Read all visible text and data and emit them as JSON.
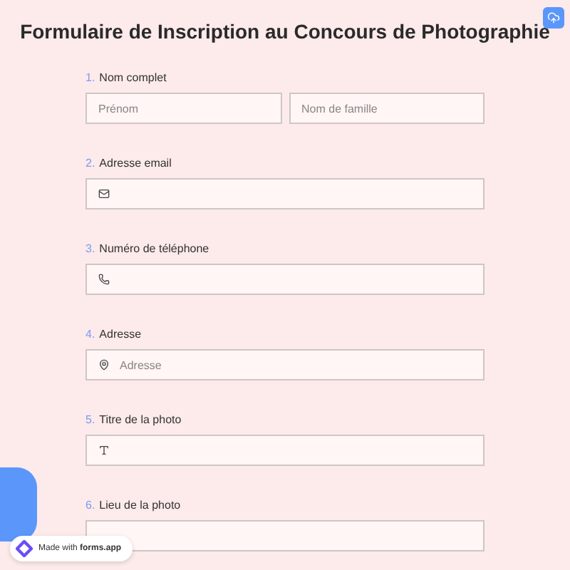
{
  "title": "Formulaire de Inscription au Concours de Photographie",
  "questions": [
    {
      "number": "1.",
      "label": "Nom complet",
      "kind": "name",
      "fields": [
        "Prénom",
        "Nom de famille"
      ]
    },
    {
      "number": "2.",
      "label": "Adresse email",
      "kind": "email"
    },
    {
      "number": "3.",
      "label": "Numéro de téléphone",
      "kind": "phone"
    },
    {
      "number": "4.",
      "label": "Adresse",
      "kind": "address",
      "fields": [
        "Adresse"
      ]
    },
    {
      "number": "5.",
      "label": "Titre de la photo",
      "kind": "text"
    },
    {
      "number": "6.",
      "label": "Lieu de la photo",
      "kind": "plain"
    }
  ],
  "badge": {
    "text": "Made with **forms.app**"
  }
}
